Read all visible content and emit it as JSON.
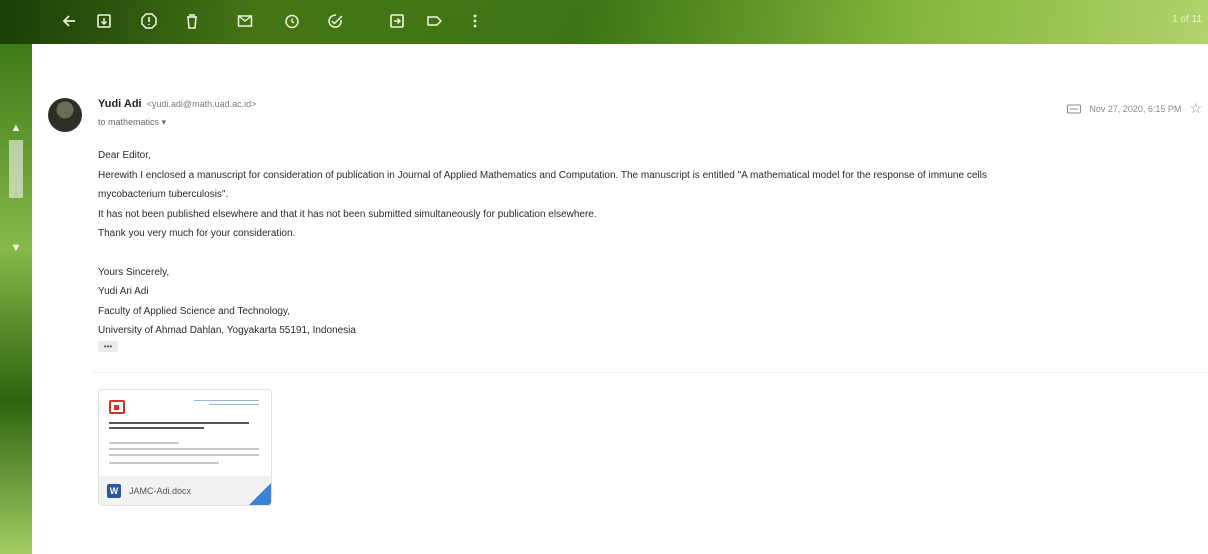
{
  "toolbar": {
    "icons": [
      "back-arrow-icon",
      "archive-icon",
      "report-spam-icon",
      "delete-icon",
      "mark-unread-icon",
      "snooze-icon",
      "add-task-icon",
      "move-to-icon",
      "labels-icon",
      "more-options-icon"
    ],
    "pager": "1 of 11"
  },
  "message": {
    "sender_name": "Yudi Adi",
    "sender_email": "<yudi.adi@math.uad.ac.id>",
    "recipient": "to mathematics ▾",
    "date": "Nov 27, 2020, 6:15 PM",
    "body": {
      "greeting": "Dear Editor,",
      "line1": "Herewith I enclosed a manuscript for consideration of publication in Journal of Applied Mathematics and Computation. The manuscript is entitled \"A mathematical model for the response of immune cells",
      "line2": "mycobacterium tuberculosis\".",
      "line3": "It has not been published elsewhere and that it has not been submitted simultaneously for publication elsewhere.",
      "line4": "Thank you very much for your consideration.",
      "closing": "Yours Sincerely,",
      "signature_name": "Yudi Ari Adi",
      "signature_faculty": "Faculty of Applied Science and Technology,",
      "signature_university": "University of Ahmad Dahlan, Yogyakarta 55191, Indonesia"
    },
    "trimmed_content_label": "•••",
    "attachment": {
      "filename": "JAMC-Adi.docx",
      "type_letter": "W"
    }
  },
  "colors": {
    "word_blue": "#2b579a",
    "accent_red": "#d32f2f",
    "theme_green": "#5e9a20"
  }
}
